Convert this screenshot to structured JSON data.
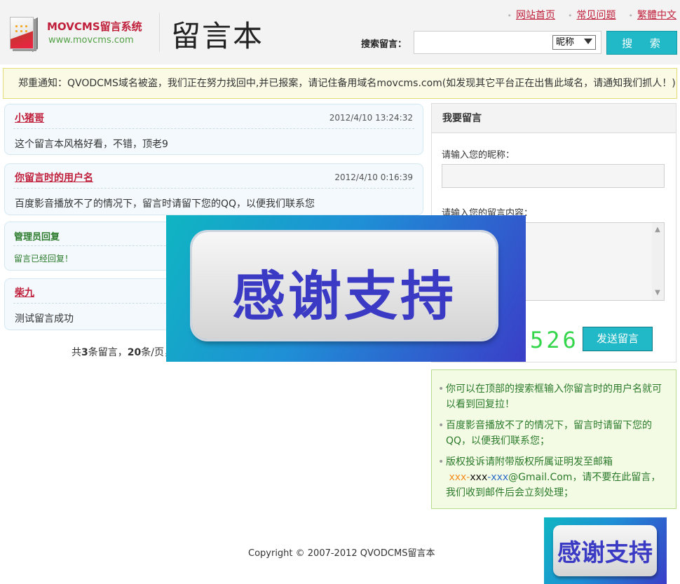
{
  "header": {
    "brand_name": "MOVCMS留言系统",
    "brand_url": "www.movcms.com",
    "site_title": "留言本",
    "links": [
      {
        "label": "网站首页"
      },
      {
        "label": "常见问题"
      },
      {
        "label": "繁體中文"
      }
    ],
    "link_bullet": "•",
    "search": {
      "label": "搜索留言：",
      "input_value": "",
      "select_value": "昵称",
      "button_label": "搜 索"
    }
  },
  "notice": "郑重通知：QVODCMS域名被盗，我们正在努力找回中,并已报案，请记住备用域名movcms.com(如发现其它平台正在出售此域名，请通知我们抓人！)",
  "messages": [
    {
      "author": "小猪哥",
      "time": "2012/4/10 13:24:32",
      "content": "这个留言本风格好看，不错，顶老9"
    },
    {
      "author": "你留言时的用户名",
      "time": "2012/4/10 0:16:39",
      "content": "百度影音播放不了的情况下，留言时请留下您的QQ，以便我们联系您",
      "reply": {
        "title": "管理员回复",
        "content": "留言已经回复！"
      }
    },
    {
      "author": "柴九",
      "time": "",
      "content": "测试留言成功"
    }
  ],
  "pagination": {
    "prefix": "共",
    "total": "3",
    "mid": "条留言，",
    "per_page": "20",
    "suffix": "条/页，"
  },
  "form": {
    "heading": "我要留言",
    "nickname_label": "请输入您的昵称：",
    "nickname_value": "",
    "content_label": "请输入您的留言内容：",
    "content_value": "",
    "captcha": "526",
    "send_label": "发送留言"
  },
  "tips": [
    {
      "text": "你可以在顶部的搜索框输入你留言时的用户名就可以看到回复拉！"
    },
    {
      "text": "百度影音播放不了的情况下，留言时请留下您的QQ，以便我们联系您；"
    },
    {
      "text_before": "版权投诉请附带版权所属证明发至邮箱",
      "email_a": "xxx-",
      "email_b": "xxx",
      "email_c": "-xxx",
      "email_d": "@Gmail.Com",
      "text_after": "，请不要在此留言，我们收到邮件后会立刻处理；"
    }
  ],
  "tip_bullet": "•",
  "banner_text": "感谢支持",
  "copyright": "Copyright © 2007-2012 QVODCMS留言本",
  "colors": {
    "accent": "#21b9c7",
    "author": "#c0203b",
    "reply": "#2a7a2a",
    "banner": "#3b3ac4"
  }
}
